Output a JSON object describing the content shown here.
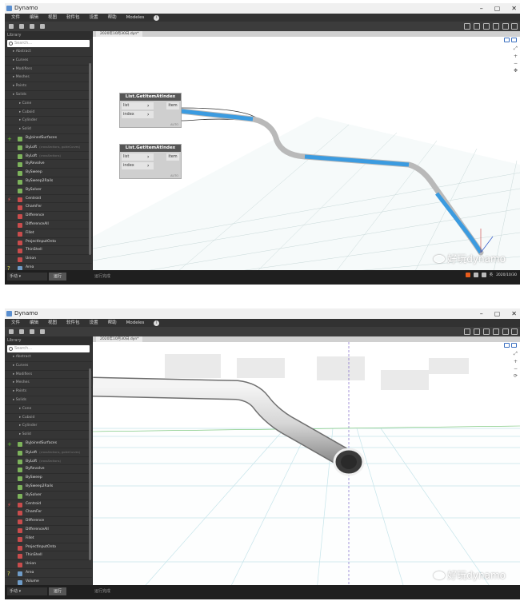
{
  "window": {
    "title": "Dynamo"
  },
  "menu": [
    "文件",
    "编辑",
    "视图",
    "软件包",
    "设置",
    "帮助",
    "Modeles"
  ],
  "library": {
    "header": "Library",
    "search_placeholder": "Search...",
    "categories": [
      {
        "label": "Abstract",
        "level": "cat"
      },
      {
        "label": "Curves",
        "level": "cat"
      },
      {
        "label": "Modifiers",
        "level": "cat"
      },
      {
        "label": "Meshes",
        "level": "cat"
      },
      {
        "label": "Points",
        "level": "cat"
      },
      {
        "label": "Solids",
        "level": "cat"
      },
      {
        "label": "Cone",
        "level": "sub"
      },
      {
        "label": "Cuboid",
        "level": "sub"
      },
      {
        "label": "Cylinder",
        "level": "sub"
      },
      {
        "label": "Solid",
        "level": "sub"
      }
    ],
    "nodes": [
      {
        "label": "ByJoinedSurfaces",
        "mark": "add",
        "side": "+"
      },
      {
        "label": "ByLoft",
        "mark": "add",
        "hint": "(crossSections, guideCurves)"
      },
      {
        "label": "ByLoft",
        "mark": "add",
        "hint": "(crossSections)"
      },
      {
        "label": "ByRevolve",
        "mark": "add"
      },
      {
        "label": "BySweep",
        "mark": "add"
      },
      {
        "label": "BySweep2Rails",
        "mark": "add"
      },
      {
        "label": "BySolver",
        "mark": "add"
      },
      {
        "label": "Centroid",
        "mark": "action",
        "side": "⚡"
      },
      {
        "label": "ChamFer",
        "mark": "action"
      },
      {
        "label": "Difference",
        "mark": "action"
      },
      {
        "label": "DifferenceAll",
        "mark": "action"
      },
      {
        "label": "Fillet",
        "mark": "action"
      },
      {
        "label": "ProjectInputOnto",
        "mark": "action"
      },
      {
        "label": "ThinShell",
        "mark": "action"
      },
      {
        "label": "Union",
        "mark": "action"
      },
      {
        "label": "Area",
        "mark": "query",
        "side": "?"
      },
      {
        "label": "Volume",
        "mark": "query"
      },
      {
        "label": "Sphere",
        "mark": "query"
      }
    ]
  },
  "tab": {
    "label": "2020年10月30日.dyn*"
  },
  "nodes_graph": [
    {
      "title": "List.GetItemAtIndex",
      "in1": "list",
      "in2": "index",
      "out": "item",
      "lacing": "AUTO"
    },
    {
      "title": "List.GetItemAtIndex",
      "in1": "list",
      "in2": "index",
      "out": "item",
      "lacing": "AUTO"
    }
  ],
  "watermark": {
    "text": "好玩dynamo"
  },
  "statusbar": {
    "run_mode": "手动",
    "run_label": "运行",
    "status": "运行完成"
  },
  "taskbar": {
    "lang": "英",
    "time": "2020/10/30"
  }
}
